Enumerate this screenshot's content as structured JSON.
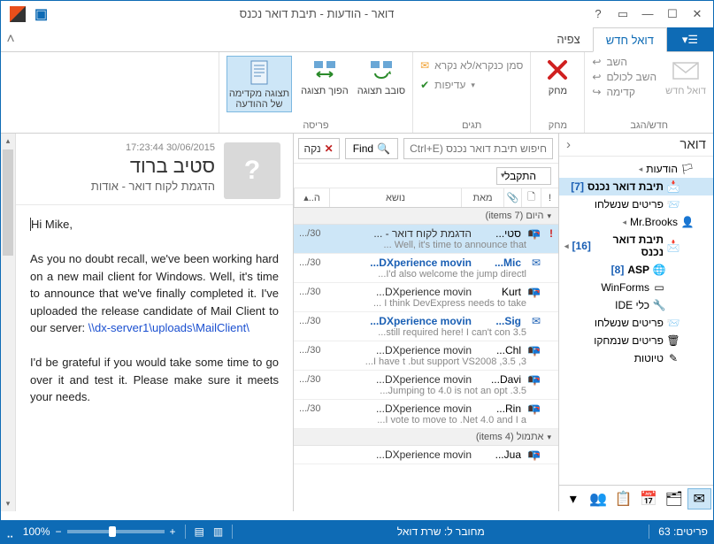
{
  "window": {
    "title": "דואר - הודעות - תיבת דואר נכנס"
  },
  "tabs": {
    "file_glyph": "☰▾",
    "mailnew": "דואל חדש",
    "view": "צפיה"
  },
  "ribbon": {
    "groups": {
      "new": {
        "label": "חדש/הגב",
        "mailnew": "דואל חדש",
        "reply": "השב",
        "replyall": "השב לכולם",
        "forward": "קדימה"
      },
      "delete": {
        "label": "מחק",
        "delete": "מחק"
      },
      "tags": {
        "label": "תגים",
        "unread": "סמן כנקרא/לא נקרא",
        "priority": "עדיפות"
      },
      "layout": {
        "label": "פריסה",
        "rotate": "סובב תצוגה",
        "flip": "הפוך תצוגה",
        "preview": "תצוגה מקדימה\nשל ההודעה"
      }
    }
  },
  "nav": {
    "title": "דואר",
    "nodes": {
      "announcements": "הודעות",
      "inbox": "תיבת דואר נכנס",
      "inbox_cnt": "[7]",
      "sent": "פריטים שנשלחו",
      "brooks": "Mr.Brooks",
      "inbox2": "תיבת דואר נכנס",
      "inbox2_cnt": "[16]",
      "asp": "ASP",
      "asp_cnt": "[8]",
      "winforms": "WinForms",
      "ide": "כלי IDE",
      "sent2": "פריטים שנשלחו",
      "deleted": "פריטים שנמחקו",
      "drafts": "טיוטות"
    }
  },
  "search": {
    "placeholder": "חיפוש תיבת דואר נכנס (Ctrl+E)",
    "find": "Find",
    "clear": "נקה"
  },
  "arrange": {
    "label": "התקבל"
  },
  "cols": {
    "from": "מאת",
    "subj": "נושא",
    "date": "ה.."
  },
  "groups": {
    "today": "היום (7 items)",
    "yesterday": "אתמול (4 items)"
  },
  "messages": [
    {
      "imp": "!",
      "env": "open",
      "from": "סטי...",
      "subj": "הדגמת לקוח דואר - ...",
      "date": "30/...",
      "prev": "Well, it's time to announce that ...",
      "sel": true
    },
    {
      "env": "blue",
      "from": "Mic...",
      "subj": "DXperience movin...",
      "date": "30/...",
      "prev": "I'd also welcome the jump directl...",
      "bold": true
    },
    {
      "env": "open",
      "from": "Kurt",
      "subj": "DXperience movin...",
      "date": "30/...",
      "prev": "I think DevExpress needs to take ..."
    },
    {
      "env": "blue",
      "from": "Sig...",
      "subj": "DXperience movin...",
      "date": "30/...",
      "prev": "still required here! I can't con 3.5...",
      "bold": true
    },
    {
      "env": "open",
      "from": "Chl...",
      "subj": "DXperience movin...",
      "date": "30/...",
      "prev": "I have t .but support VS2008 ,3.5 ,3..."
    },
    {
      "env": "open",
      "from": "Davi...",
      "subj": "DXperience movin...",
      "date": "30/...",
      "prev": "Jumping to 4.0 is not an opt .3.5..."
    },
    {
      "env": "open",
      "from": "Rin...",
      "subj": "DXperience movin...",
      "date": "30/...",
      "prev": "I vote to move to .Net 4.0 and I a..."
    }
  ],
  "messages2": [
    {
      "env": "open",
      "from": "Jua...",
      "subj": "DXperience movin...",
      "date": "",
      "prev": ""
    }
  ],
  "reading": {
    "date": "30/06/2015 17:23:44",
    "from": "סטיב ברוד",
    "subj": "הדגמת לקוח דואר - אודות",
    "greeting": "Hi Mike,",
    "p1a": "As you no doubt recall, we've been working hard on a new mail client for Windows. Well, it's time to announce that we've finally completed it. I've uploaded the release candidate of Mail Client to our server: ",
    "link": "\\\\dx-server1\\uploads\\MailClient\\",
    "p2": "I'd be grateful if you would take some time to go over it and test it. Please make sure it meets your needs."
  },
  "status": {
    "items": "פריטים: 63",
    "connected": "מחובר ל: שרת דואל",
    "zoom": "100%"
  }
}
